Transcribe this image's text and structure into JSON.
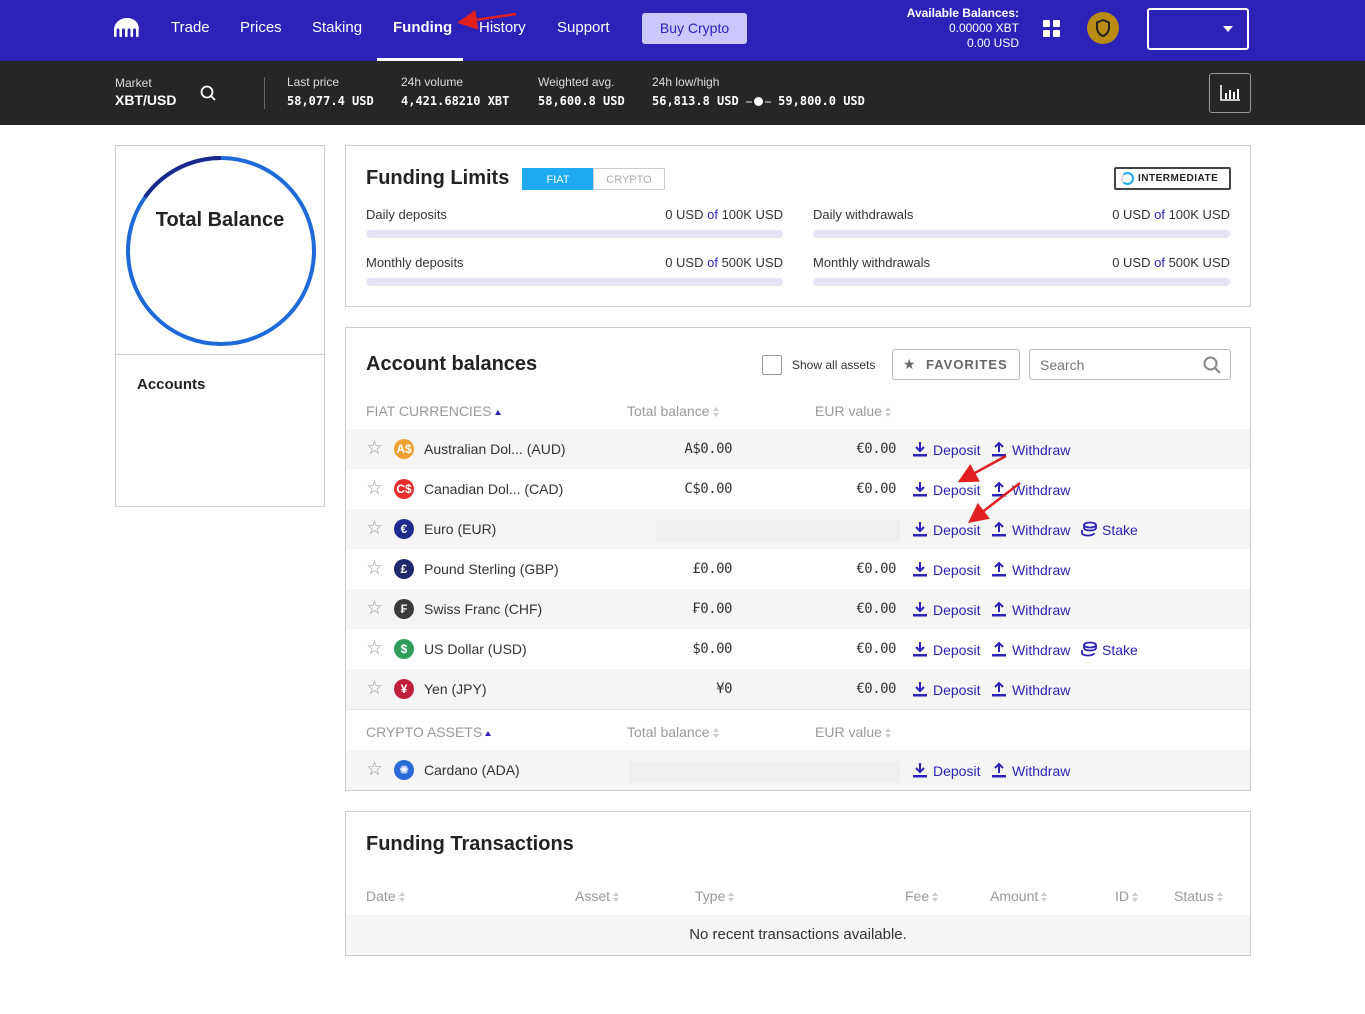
{
  "nav": {
    "items": [
      {
        "label": "Trade",
        "active": false
      },
      {
        "label": "Prices",
        "active": false
      },
      {
        "label": "Staking",
        "active": false
      },
      {
        "label": "Funding",
        "active": true
      },
      {
        "label": "History",
        "active": false
      },
      {
        "label": "Support",
        "active": false
      }
    ],
    "buy_label": "Buy Crypto",
    "balances_title": "Available Balances:",
    "balance_xbt": "0.00000 XBT",
    "balance_usd": "0.00 USD",
    "account_selector": ""
  },
  "ticker": {
    "market_label": "Market",
    "pair": "XBT/USD",
    "last_price_label": "Last price",
    "last_price": "58,077.4 USD",
    "volume_label": "24h volume",
    "volume": "4,421.68210 XBT",
    "wavg_label": "Weighted avg.",
    "wavg": "58,600.8 USD",
    "lowhigh_label": "24h low/high",
    "low": "56,813.8 USD",
    "high": "59,800.0 USD"
  },
  "total": {
    "title": "Total Balance",
    "accounts_label": "Accounts"
  },
  "limits": {
    "title": "Funding Limits",
    "tab_fiat": "FIAT",
    "tab_crypto": "CRYPTO",
    "tier": "INTERMEDIATE",
    "items": [
      {
        "label": "Daily deposits",
        "used": "0 USD",
        "of": "of",
        "max": "100K USD",
        "fraction": 0
      },
      {
        "label": "Daily withdrawals",
        "used": "0 USD",
        "of": "of",
        "max": "100K USD",
        "fraction": 0
      },
      {
        "label": "Monthly deposits",
        "used": "0 USD",
        "of": "of",
        "max": "500K USD",
        "fraction": 0
      },
      {
        "label": "Monthly withdrawals",
        "used": "0 USD",
        "of": "of",
        "max": "500K USD",
        "fraction": 0
      }
    ]
  },
  "balances": {
    "title": "Account balances",
    "show_all": "Show all assets",
    "favorites": "FAVORITES",
    "search_placeholder": "Search",
    "fiat_header": "FIAT CURRENCIES",
    "crypto_header": "CRYPTO ASSETS",
    "col_total": "Total balance",
    "col_eur": "EUR value",
    "deposit": "Deposit",
    "withdraw": "Withdraw",
    "stake": "Stake",
    "fiat": [
      {
        "symbol": "A$",
        "color": "#f0a030",
        "name": "Australian Dol...  (AUD)",
        "total": "A$0.00",
        "eur": "€0.00",
        "stake": false
      },
      {
        "symbol": "C$",
        "color": "#e52e2e",
        "name": "Canadian Dol...  (CAD)",
        "total": "C$0.00",
        "eur": "€0.00",
        "stake": false
      },
      {
        "symbol": "€",
        "color": "#1e2a8c",
        "name": "Euro (EUR)",
        "total": "",
        "eur": "",
        "stake": true
      },
      {
        "symbol": "£",
        "color": "#1e2a6c",
        "name": "Pound Sterling (GBP)",
        "total": "£0.00",
        "eur": "€0.00",
        "stake": false
      },
      {
        "symbol": "₣",
        "color": "#3a3a3a",
        "name": "Swiss Franc (CHF)",
        "total": "₣0.00",
        "eur": "€0.00",
        "stake": false
      },
      {
        "symbol": "$",
        "color": "#2e9e5a",
        "name": "US Dollar (USD)",
        "total": "$0.00",
        "eur": "€0.00",
        "stake": true
      },
      {
        "symbol": "¥",
        "color": "#c01f3c",
        "name": "Yen (JPY)",
        "total": "¥0",
        "eur": "€0.00",
        "stake": false
      }
    ],
    "crypto": [
      {
        "symbol": "✺",
        "color": "#2a6ad8",
        "name": "Cardano (ADA)",
        "total": "",
        "eur": "",
        "stake": false
      }
    ]
  },
  "transactions": {
    "title": "Funding Transactions",
    "columns": [
      "Date",
      "Asset",
      "Type",
      "Fee",
      "Amount",
      "ID",
      "Status"
    ],
    "empty": "No recent transactions available."
  },
  "colors": {
    "brand": "#2c22b8",
    "accent": "#1eaaf1",
    "annotation": "#e02020"
  },
  "icons": [
    "kraken-logo-icon",
    "grid-icon",
    "shield-icon",
    "chevron-down-icon",
    "search-icon",
    "chart-icon",
    "star-icon",
    "download-icon",
    "upload-icon",
    "coins-icon"
  ]
}
